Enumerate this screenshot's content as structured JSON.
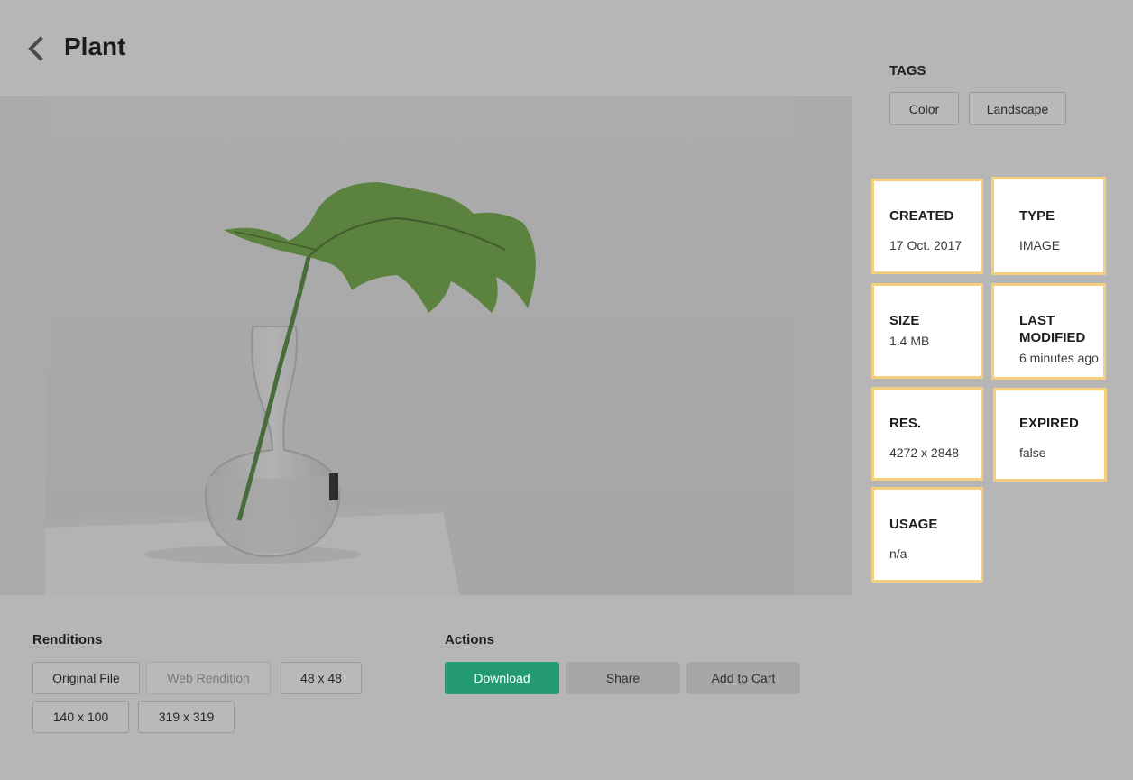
{
  "header": {
    "title": "Plant",
    "back_icon": "chevron-left-icon"
  },
  "image": {
    "alt": "Plant"
  },
  "renditions": {
    "title": "Renditions",
    "items": [
      {
        "label": "Original File",
        "enabled": true
      },
      {
        "label": "Web Rendition",
        "enabled": false
      },
      {
        "label": "48 x 48",
        "enabled": true
      },
      {
        "label": "140 x 100",
        "enabled": true
      },
      {
        "label": "319 x 319",
        "enabled": true
      }
    ]
  },
  "actions": {
    "title": "Actions",
    "download": "Download",
    "share": "Share",
    "add_to_cart": "Add to Cart"
  },
  "tags": {
    "title": "TAGS",
    "items": [
      "Color",
      "Landscape"
    ]
  },
  "metadata": {
    "created": {
      "label": "CREATED",
      "value": "17 Oct. 2017"
    },
    "type": {
      "label": "TYPE",
      "value": "IMAGE"
    },
    "size": {
      "label": "SIZE",
      "value": "1.4 MB"
    },
    "last_modified": {
      "label": "LAST MODIFIED",
      "value": "6 minutes ago"
    },
    "res": {
      "label": "RES.",
      "value": "4272 x 2848"
    },
    "expired": {
      "label": "EXPIRED",
      "value": "false"
    },
    "usage": {
      "label": "USAGE",
      "value": "n/a"
    }
  },
  "colors": {
    "accent": "#249a72",
    "card_border": "#f3cf7d",
    "overlay": "#b6b6b6"
  }
}
